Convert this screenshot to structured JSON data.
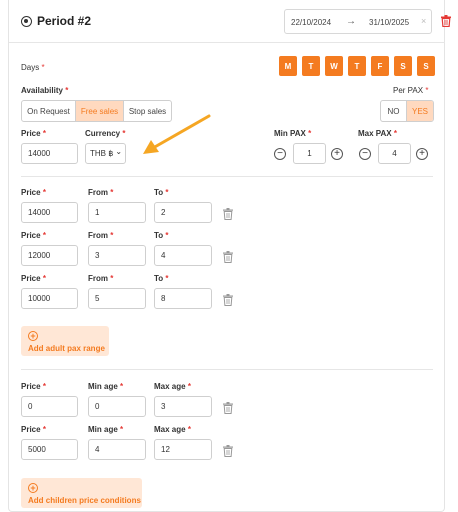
{
  "header": {
    "title": "Period #2",
    "date_from": "22/10/2024",
    "date_to": "31/10/2025",
    "arrow": "→",
    "clear": "×"
  },
  "days": {
    "label": "Days",
    "required": "*",
    "items": [
      "M",
      "T",
      "W",
      "T",
      "F",
      "S",
      "S"
    ]
  },
  "availability": {
    "label": "Availability",
    "required": "*",
    "options": [
      "On Request",
      "Free sales",
      "Stop sales"
    ],
    "selected": "Free sales"
  },
  "per_pax": {
    "label": "Per PAX",
    "required": "*",
    "options": [
      "NO",
      "YES"
    ],
    "selected": "YES"
  },
  "base": {
    "price_label": "Price",
    "price_value": "14000",
    "currency_label": "Currency",
    "currency_value": "THB ฿",
    "currency_caret": "⌄",
    "min_pax_label": "Min PAX",
    "min_pax_value": "1",
    "max_pax_label": "Max PAX",
    "max_pax_value": "4",
    "minus": "−",
    "plus": "+",
    "required": "*"
  },
  "adult_ranges": {
    "price_label": "Price",
    "from_label": "From",
    "to_label": "To",
    "rows": [
      {
        "price": "14000",
        "from": "1",
        "to": "2"
      },
      {
        "price": "12000",
        "from": "3",
        "to": "4"
      },
      {
        "price": "10000",
        "from": "5",
        "to": "8"
      }
    ],
    "add_label": "Add adult pax range"
  },
  "children": {
    "price_label": "Price",
    "min_age_label": "Min age",
    "max_age_label": "Max age",
    "rows": [
      {
        "price": "0",
        "min_age": "0",
        "max_age": "3"
      },
      {
        "price": "5000",
        "min_age": "4",
        "max_age": "12"
      }
    ],
    "add_label": "Add children price conditions"
  },
  "colors": {
    "accent": "#f47b20",
    "accent_light": "#ffe7d6",
    "danger": "#e53935",
    "border": "#cfcfcf"
  },
  "icons": [
    "radio-target-icon",
    "arrow-right-icon",
    "close-icon",
    "trash-icon",
    "minus-circle-icon",
    "plus-circle-icon",
    "chevron-down-icon",
    "arrow-annotation-icon"
  ]
}
